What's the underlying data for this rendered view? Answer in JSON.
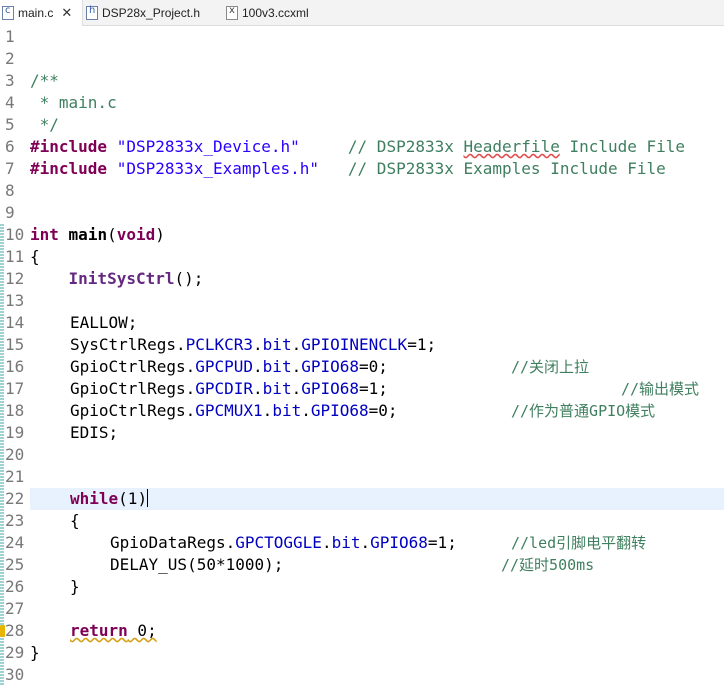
{
  "tabs": [
    {
      "label": "main.c",
      "icon": "c-file-icon",
      "close": "✕"
    },
    {
      "label": "DSP28x_Project.h",
      "icon": "h-file-icon"
    },
    {
      "label": "100v3.ccxml",
      "icon": "xml-file-icon"
    }
  ],
  "lines": {
    "n1": "1",
    "n2": "2",
    "n3": "3",
    "n4": "4",
    "n5": "5",
    "n6": "6",
    "n7": "7",
    "n8": "8",
    "n9": "9",
    "n10": "10",
    "n11": "11",
    "n12": "12",
    "n13": "13",
    "n14": "14",
    "n15": "15",
    "n16": "16",
    "n17": "17",
    "n18": "18",
    "n19": "19",
    "n20": "20",
    "n21": "21",
    "n22": "22",
    "n23": "23",
    "n24": "24",
    "n25": "25",
    "n26": "26",
    "n27": "27",
    "n28": "28",
    "n29": "29",
    "n30": "30"
  },
  "code": {
    "l3": "/**",
    "l4": " * main.c",
    "l5": " */",
    "l6_inc": "#include",
    "l6_str": "\"DSP2833x_Device.h\"",
    "l6_cmt_a": "// DSP2833x ",
    "l6_cmt_b": "Headerfile",
    "l6_cmt_c": " Include File",
    "l7_inc": "#include",
    "l7_str": "\"DSP2833x_Examples.h\"",
    "l7_cmt": "// DSP2833x Examples Include File",
    "l10_int": "int",
    "l10_main": "main",
    "l10_paren_open": "(",
    "l10_void": "void",
    "l10_paren_close": ")",
    "l11": "{",
    "l12_fn": "InitSysCtrl",
    "l12_rest": "();",
    "l14": "EALLOW;",
    "l15_a": "SysCtrlRegs.",
    "l15_b": "PCLKCR3",
    "l15_c": ".",
    "l15_d": "bit",
    "l15_e": ".",
    "l15_f": "GPIOINENCLK",
    "l15_g": "=1;",
    "l16_a": "GpioCtrlRegs.",
    "l16_b": "GPCPUD",
    "l16_c": ".",
    "l16_d": "bit",
    "l16_e": ".",
    "l16_f": "GPIO68",
    "l16_g": "=0;",
    "l16_cmt": "//关闭上拉",
    "l17_a": "GpioCtrlRegs.",
    "l17_b": "GPCDIR",
    "l17_c": ".",
    "l17_d": "bit",
    "l17_e": ".",
    "l17_f": "GPIO68",
    "l17_g": "=1;",
    "l17_cmt": "//输出模式",
    "l18_a": "GpioCtrlRegs.",
    "l18_b": "GPCMUX1",
    "l18_c": ".",
    "l18_d": "bit",
    "l18_e": ".",
    "l18_f": "GPIO68",
    "l18_g": "=0;",
    "l18_cmt": "//作为普通GPIO模式",
    "l19": "EDIS;",
    "l22_kw": "while",
    "l22_rest": "(1)",
    "l23": "{",
    "l24_a": "GpioDataRegs.",
    "l24_b": "GPCTOGGLE",
    "l24_c": ".",
    "l24_d": "bit",
    "l24_e": ".",
    "l24_f": "GPIO68",
    "l24_g": "=1;",
    "l24_cmt": "//led引脚电平翻转",
    "l25": "DELAY_US(50*1000);",
    "l25_cmt": "//延时500ms",
    "l26": "}",
    "l28_kw": "return",
    "l28_rest": " 0;",
    "l29": "}"
  },
  "colors": {
    "keyword": "#7f0055",
    "string": "#2a00ff",
    "comment": "#3f7f5f",
    "field": "#0000c0",
    "current_line": "#e8f2fe",
    "warning_marker": "#e8b400"
  }
}
